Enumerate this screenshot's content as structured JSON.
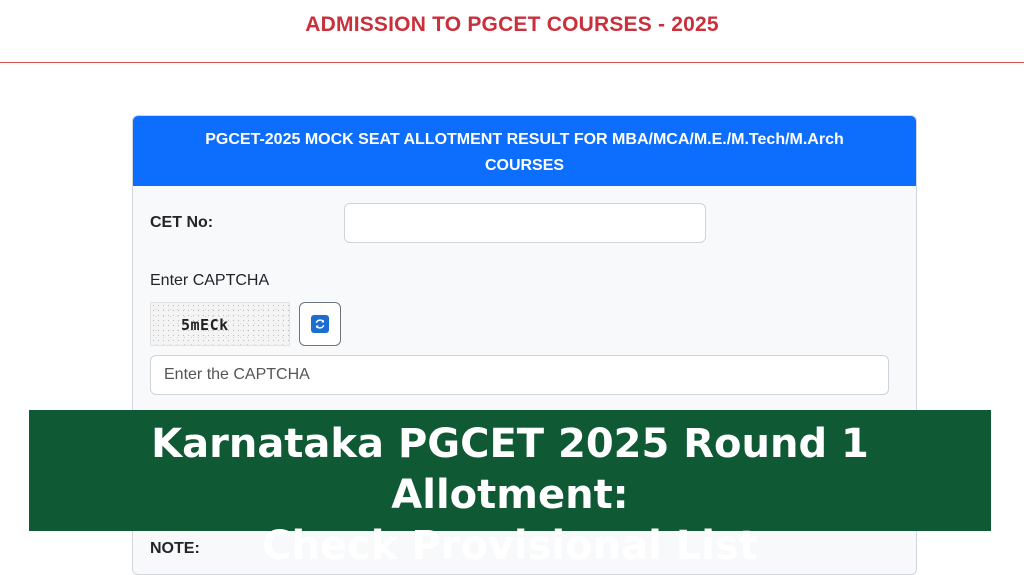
{
  "header": {
    "title": "ADMISSION TO PGCET COURSES - 2025"
  },
  "card": {
    "title": "PGCET-2025 MOCK SEAT ALLOTMENT RESULT FOR MBA/MCA/M.E./M.Tech/M.Arch COURSES",
    "cet_label": "CET No:",
    "cet_value": "",
    "captcha_label": "Enter CAPTCHA",
    "captcha_code": "5mECk",
    "captcha_placeholder": "Enter the CAPTCHA",
    "note_label": "NOTE:"
  },
  "banner": {
    "line1": "Karnataka PGCET 2025 Round 1 Allotment:",
    "line2": "Check Provisional List"
  },
  "colors": {
    "header_text": "#c9303c",
    "card_header_bg": "#0d6efd",
    "banner_bg": "#0f5a34"
  },
  "icons": {
    "refresh": "refresh-icon"
  }
}
